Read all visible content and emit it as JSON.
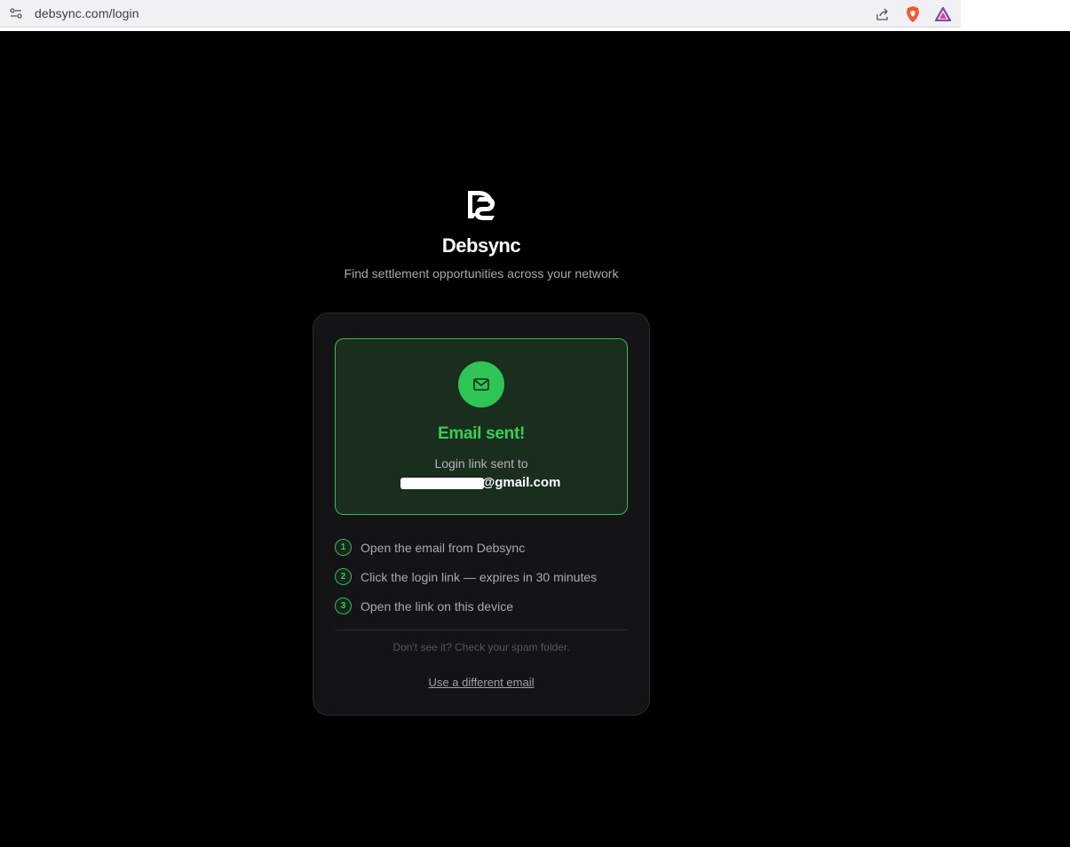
{
  "browser": {
    "url": "debsync.com/login",
    "icons": [
      "site-settings-icon",
      "share-icon",
      "brave-shield-icon",
      "brave-rewards-icon"
    ]
  },
  "brand": {
    "logo": "debsync-logo",
    "name": "Debsync",
    "tagline": "Find settlement opportunities across your network"
  },
  "confirmation": {
    "icon": "mail-icon",
    "title": "Email sent!",
    "label": "Login link sent to",
    "email": "████████@gmail.com",
    "email_visible": "@gmail.com"
  },
  "steps": [
    {
      "number": "1",
      "text": "Open the email from Debsync"
    },
    {
      "number": "2",
      "text": "Click the login link — expires in 30 minutes"
    },
    {
      "number": "3",
      "text": "Open the link on this device"
    }
  ],
  "footer": {
    "spam_note": "Don't see it? Check your spam folder.",
    "different_email_link": "Use a different email"
  },
  "colors": {
    "background": "#000000",
    "card": "#141416",
    "accent_green": "#2dc553",
    "success_bg": "#1a2e1e"
  }
}
